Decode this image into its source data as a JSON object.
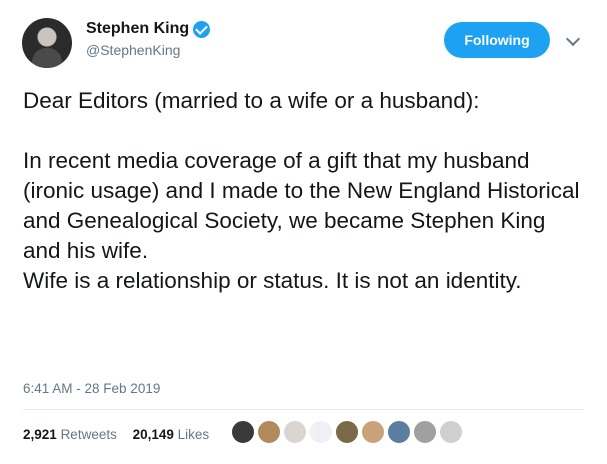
{
  "tweet": {
    "author": {
      "display_name": "Stephen King",
      "handle": "@StephenKing",
      "verified": true,
      "avatar_icon": "profile-photo"
    },
    "follow_button_label": "Following",
    "menu_icon": "chevron-down-icon",
    "text": "Dear Editors (married to a wife or a husband):\n\nIn recent media coverage of a gift that my husband (ironic usage) and I made to the New England Historical and Genealogical Society, we became Stephen King and his wife.\nWife is a relationship or status. It is not an identity.",
    "timestamp": "6:41 AM - 28 Feb 2019",
    "stats": {
      "retweets_count": "2,921",
      "retweets_label": "Retweets",
      "likes_count": "20,149",
      "likes_label": "Likes"
    },
    "liker_avatars": [
      {
        "name": "liker-avatar-1",
        "color": "#3a3a3a"
      },
      {
        "name": "liker-avatar-2",
        "color": "#b08a5a"
      },
      {
        "name": "liker-avatar-3",
        "color": "#d9d6d2"
      },
      {
        "name": "liker-avatar-4",
        "color": "#f2eef5"
      },
      {
        "name": "liker-avatar-5",
        "color": "#7a6a4a"
      },
      {
        "name": "liker-avatar-6",
        "color": "#c9a27a"
      },
      {
        "name": "liker-avatar-7",
        "color": "#5a7ea0"
      },
      {
        "name": "liker-avatar-8",
        "color": "#a0a0a0"
      },
      {
        "name": "liker-avatar-9",
        "color": "#cfcfcf"
      }
    ]
  },
  "colors": {
    "accent": "#1da1f2",
    "text_primary": "#14171a",
    "text_secondary": "#657786",
    "divider": "#e6ecf0"
  }
}
